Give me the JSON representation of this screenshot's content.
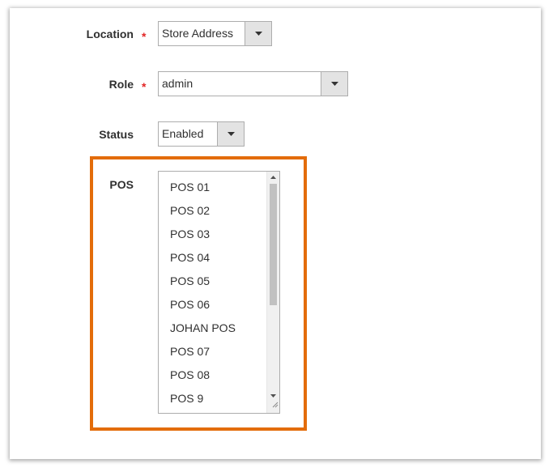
{
  "form": {
    "location": {
      "label": "Location",
      "required_mark": "*",
      "value": "Store Address"
    },
    "role": {
      "label": "Role",
      "required_mark": "*",
      "value": "admin"
    },
    "status": {
      "label": "Status",
      "value": "Enabled"
    },
    "pos": {
      "label": "POS",
      "options": [
        "POS 01",
        "POS 02",
        "POS 03",
        "POS 04",
        "POS 05",
        "POS 06",
        "JOHAN POS",
        "POS 07",
        "POS 08",
        "POS 9"
      ]
    }
  },
  "colors": {
    "highlight_border": "#e36c0a",
    "required_star": "#e22626",
    "text": "#303030"
  },
  "icons": {
    "dropdown": "chevron-down-icon",
    "scroll_up": "scroll-up-arrow-icon",
    "scroll_down": "scroll-down-arrow-icon",
    "resize": "resize-grip-icon"
  }
}
